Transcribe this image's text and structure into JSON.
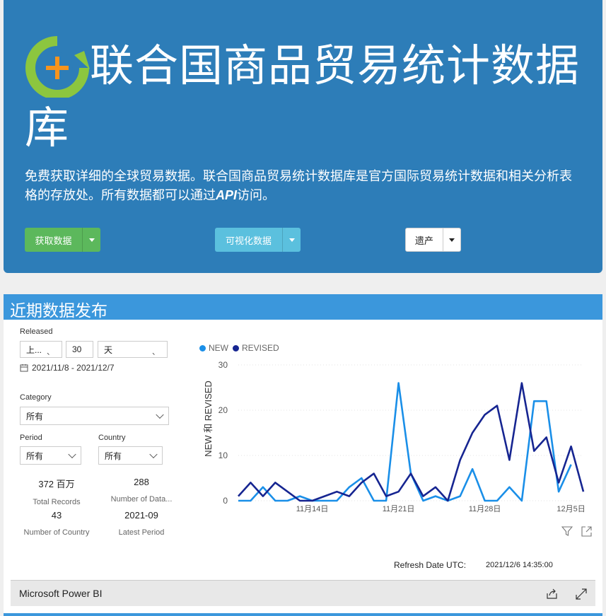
{
  "hero": {
    "title": "联合国商品贸易统计数据库",
    "desc_part1": "免费获取详细的全球贸易数据。联合国商品贸易统计数据库是官方国际贸易统计数据和相关分析表格的存放处。所有数据都可以通过",
    "desc_api": "API",
    "desc_part2": "访问。",
    "btn_get_data": "获取数据",
    "btn_visualize": "可视化数据",
    "btn_legacy": "遗产"
  },
  "section": {
    "title": "近期数据发布"
  },
  "filters": {
    "released_label": "Released",
    "released_mode": "上...",
    "released_count": "30",
    "released_unit": "天",
    "date_range": "2021/11/8 - 2021/12/7",
    "category_label": "Category",
    "category_value": "所有",
    "period_label": "Period",
    "period_value": "所有",
    "country_label": "Country",
    "country_value": "所有"
  },
  "kpis": [
    {
      "value": "372 百万",
      "label": "Total Records"
    },
    {
      "value": "288",
      "label": "Number of Data..."
    },
    {
      "value": "43",
      "label": "Number of Country"
    },
    {
      "value": "2021-09",
      "label": "Latest Period"
    }
  ],
  "refresh": {
    "label": "Refresh Date UTC:",
    "value": "2021/12/6 14:35:00"
  },
  "powerbi": {
    "label": "Microsoft Power BI"
  },
  "colors": {
    "hero_bg": "#2d7db8",
    "section_bar": "#3b97dc",
    "new": "#1a8fe8",
    "revised": "#162591"
  },
  "chart_data": {
    "type": "line",
    "ylabel": "NEW 和 REVISED",
    "ylim": [
      0,
      30
    ],
    "yticks": [
      0,
      10,
      20,
      30
    ],
    "x": [
      "11/8",
      "11/9",
      "11/10",
      "11/11",
      "11/12",
      "11/13",
      "11/14",
      "11/15",
      "11/16",
      "11/17",
      "11/18",
      "11/19",
      "11/20",
      "11/21",
      "11/22",
      "11/23",
      "11/24",
      "11/25",
      "11/26",
      "11/27",
      "11/28",
      "11/29",
      "11/30",
      "12/1",
      "12/2",
      "12/3",
      "12/4",
      "12/5",
      "12/6"
    ],
    "xticks": [
      {
        "label": "11月14日",
        "index": 6
      },
      {
        "label": "11月21日",
        "index": 13
      },
      {
        "label": "11月28日",
        "index": 20
      },
      {
        "label": "12月5日",
        "index": 27
      }
    ],
    "legend": "top-left",
    "series": [
      {
        "name": "NEW",
        "color": "#1a8fe8",
        "values": [
          0,
          0,
          3,
          0,
          0,
          1,
          0,
          0,
          0,
          3,
          5,
          0,
          0,
          26,
          6,
          0,
          1,
          0,
          1,
          7,
          0,
          0,
          3,
          0,
          22,
          22,
          2,
          8,
          null
        ]
      },
      {
        "name": "REVISED",
        "color": "#162591",
        "values": [
          1,
          4,
          1,
          4,
          2,
          0,
          0,
          1,
          2,
          1,
          4,
          6,
          1,
          2,
          6,
          1,
          3,
          0,
          9,
          15,
          19,
          21,
          9,
          26,
          11,
          14,
          4,
          12,
          2
        ]
      }
    ]
  }
}
